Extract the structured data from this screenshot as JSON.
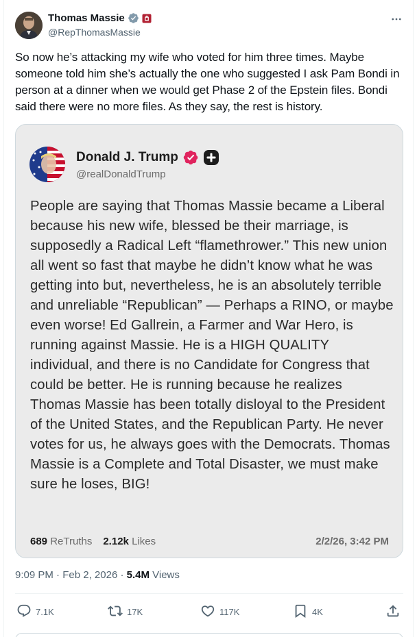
{
  "author": {
    "name": "Thomas Massie",
    "handle": "@RepThomasMassie",
    "avatar_icon": "portrait-avatar",
    "verified_icon": "verified-badge-icon",
    "affiliation_icon": "congress-seal-icon"
  },
  "tweet_text": "So now he’s attacking my wife who voted for him three times. Maybe someone told him she’s actually the one who suggested I ask Pam Bondi in person at a dinner when we would get Phase 2 of the Epstein files. Bondi said there were no more files. As they say, the rest is history.",
  "embedded_post": {
    "name": "Donald J. Trump",
    "handle": "@realDonaldTrump",
    "text": "People are saying that Thomas Massie became a Liberal because his new wife, blessed be their marriage, is supposedly a Radical Left “flamethrower.” This new union all went so fast that maybe he didn’t know what he was getting into but, nevertheless, he is an absolutely terrible and unreliable “Republican” — Perhaps a RINO, or maybe even worse! Ed Gallrein, a Farmer and War Hero, is running against Massie. He is a HIGH QUALITY individual, and there is no Candidate for Congress that could be better. He is running because he realizes Thomas Massie has been totally disloyal to the President of the United States, and the Republican Party. He never votes for us, he always goes with the Democrats. Thomas Massie is a Complete and Total Disaster, we must make sure he loses, BIG!",
    "retruths_count": "689",
    "retruths_label": "ReTruths",
    "likes_count": "2.12k",
    "likes_label": "Likes",
    "date": "2/2/26, 3:42 PM",
    "colors": {
      "verified_badge": "#e0245e",
      "background": "#ebebeb"
    }
  },
  "meta": {
    "time": "9:09 PM",
    "sep1": " · ",
    "date": "Feb 2, 2026",
    "sep2": " · ",
    "views_count": "5.4M",
    "views_label": " Views"
  },
  "actions": {
    "replies": "7.1K",
    "reposts": "17K",
    "likes": "117K",
    "bookmarks": "4K"
  },
  "colors": {
    "accent": "#1d9bf0",
    "secondary_text": "#536471",
    "verified": "#829aab"
  }
}
